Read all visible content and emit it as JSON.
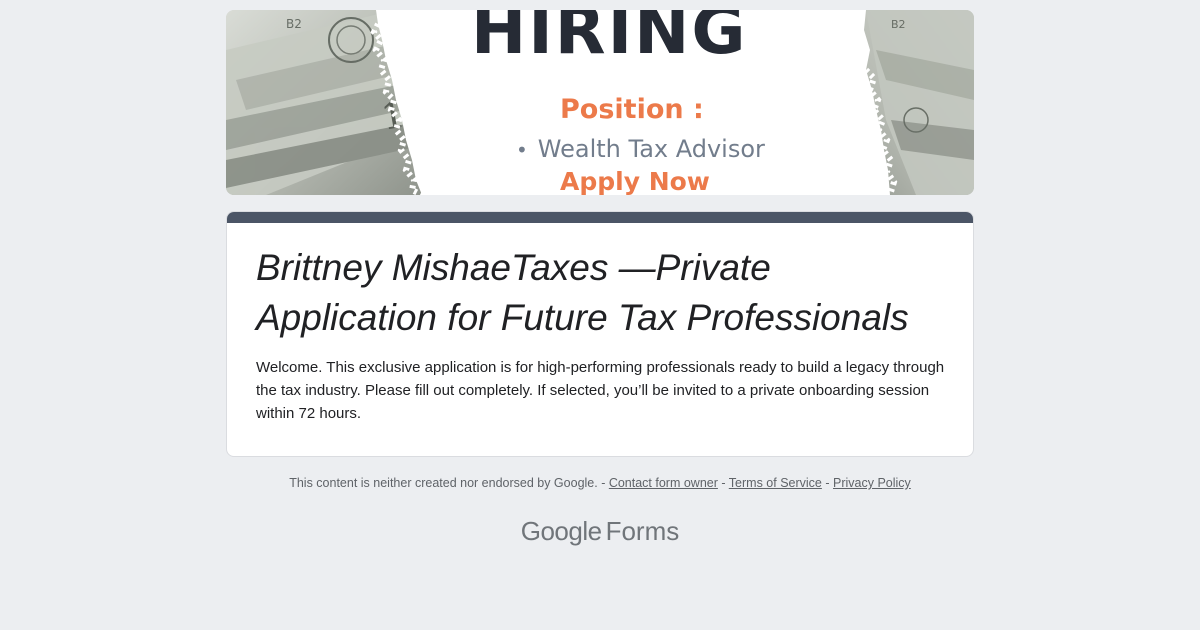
{
  "banner": {
    "headline": "HIRING",
    "position_label": "Position :",
    "bullet": "•",
    "role": "Wealth Tax Advisor",
    "cta": "Apply Now",
    "colors": {
      "headline": "#262b35",
      "accent": "#ec7a4a",
      "role": "#727d8c"
    }
  },
  "form": {
    "title": "Brittney MishaeTaxes —Private Application for Future Tax Professionals",
    "description": "Welcome. This exclusive application is for high-performing professionals ready to build a legacy through the tax industry. Please fill out completely. If selected, you’ll be invited to a private onboarding session within 72 hours.",
    "accent_color": "#4b5566"
  },
  "footer": {
    "disclaimer": "This content is neither created nor endorsed by Google.",
    "separator": " - ",
    "links": {
      "contact": "Contact form owner",
      "terms": "Terms of Service",
      "privacy": "Privacy Policy"
    }
  },
  "brand": {
    "google": "Google",
    "forms": "Forms"
  }
}
